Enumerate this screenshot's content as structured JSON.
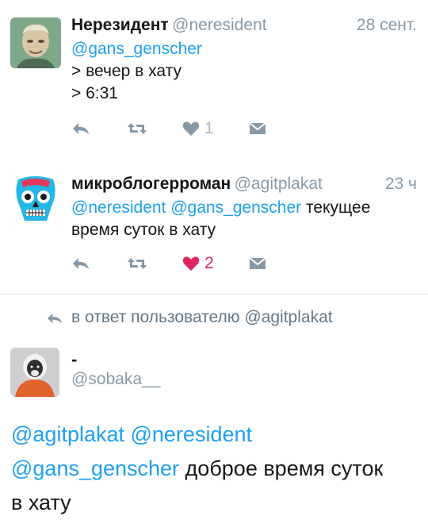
{
  "tweets": [
    {
      "name": "Нерезидент",
      "handle": "@neresident",
      "time": "28 сент.",
      "lines": [
        {
          "mention": "@gans_genscher",
          "text": ""
        },
        {
          "mention": "",
          "text": "> вечер в хату"
        },
        {
          "mention": "",
          "text": "> 6:31"
        }
      ],
      "likes": "1",
      "liked": false
    },
    {
      "name": "микроблогерроман",
      "handle": "@agitplakat",
      "time": "23 ч",
      "line1_mentions": "@neresident @gans_genscher",
      "line1_text": " текущее",
      "line2_text": "время суток в хату",
      "likes": "2",
      "liked": true
    }
  ],
  "reply_context": {
    "text": "в ответ пользователю @agitplakat"
  },
  "main_tweet": {
    "name": "-",
    "handle": "@sobaka__",
    "line1_mentions": "@agitplakat @neresident",
    "line2_mention": "@gans_genscher",
    "line2_text": " доброе время суток",
    "line3_text": "в хату"
  },
  "colors": {
    "link": "#1da1f2",
    "muted": "#8899a6",
    "icon": "#aab8c2",
    "like": "#e0245e",
    "divider": "#e1e8ed"
  },
  "icons": {
    "reply": "reply-arrow-icon",
    "retweet": "retweet-icon",
    "like": "heart-icon",
    "dm": "direct-message-icon"
  }
}
